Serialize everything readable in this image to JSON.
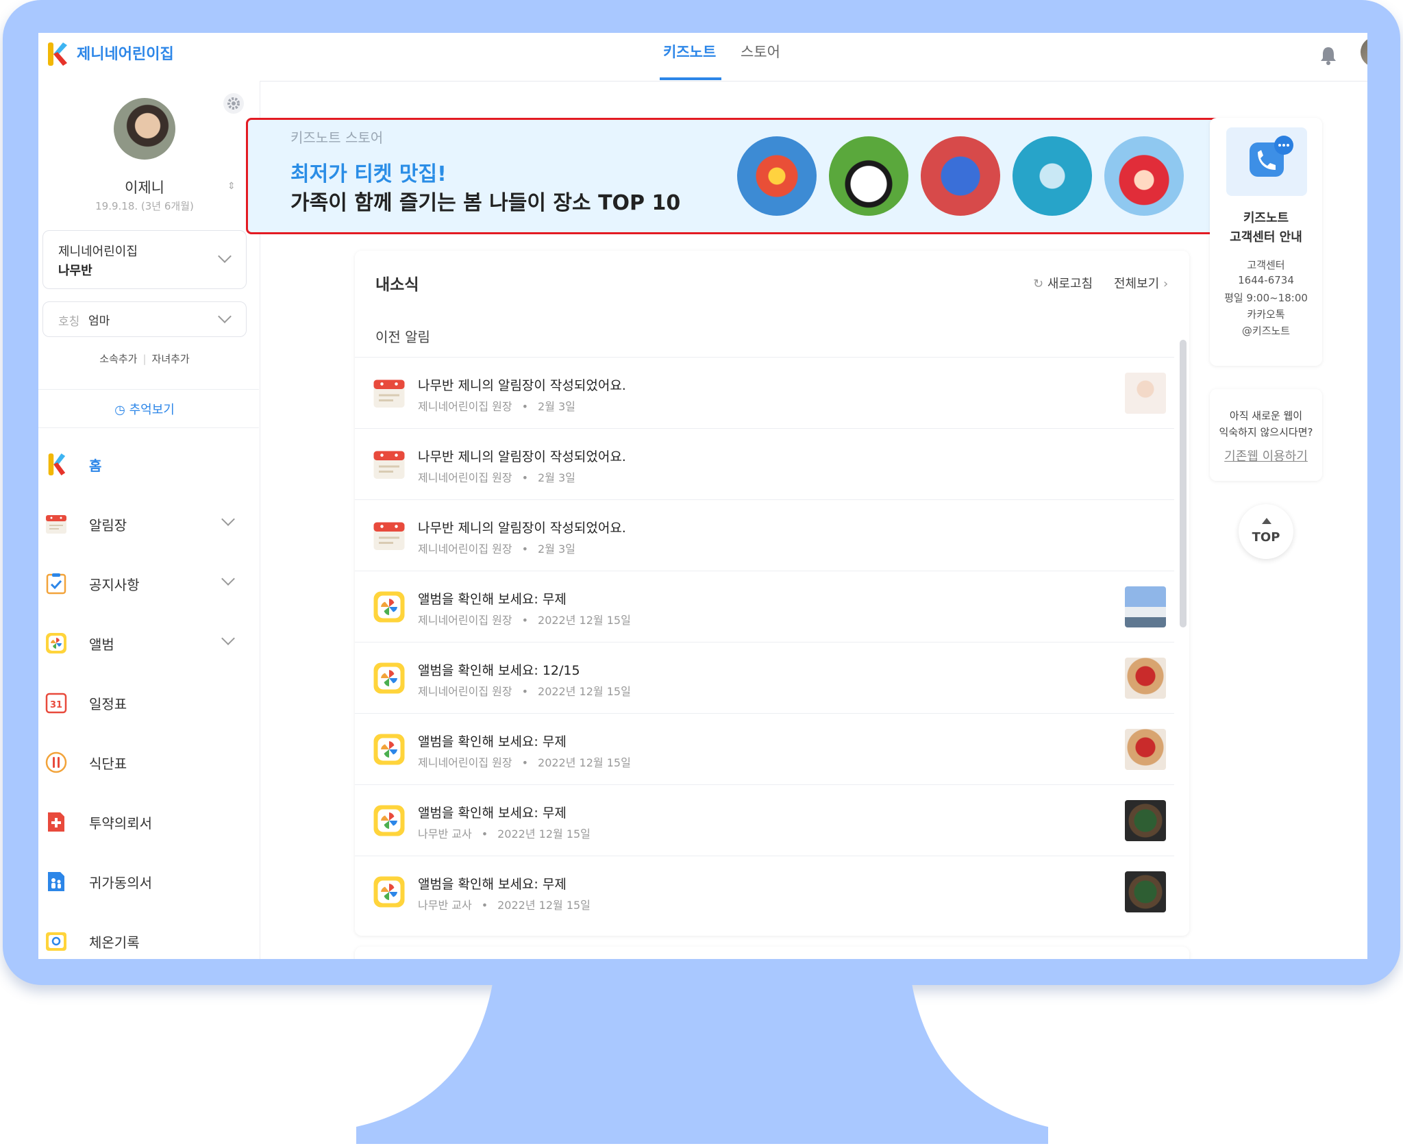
{
  "header": {
    "brand": "제니네어린이집",
    "tabs": [
      {
        "label": "키즈노트",
        "active": true
      },
      {
        "label": "스토어",
        "active": false
      }
    ]
  },
  "profile": {
    "name": "이제니",
    "birth": "19.9.18. (3년 6개월)",
    "school": "제니네어린이집",
    "class": "나무반",
    "title_label": "호칭",
    "title_value": "엄마",
    "add_affiliation": "소속추가",
    "add_child": "자녀추가",
    "memory_link": "추억보기"
  },
  "nav": [
    {
      "label": "홈",
      "active": true,
      "icon": "kidsnote-logo-icon",
      "chevron": false
    },
    {
      "label": "알림장",
      "active": false,
      "icon": "notebook-icon",
      "chevron": true
    },
    {
      "label": "공지사항",
      "active": false,
      "icon": "clipboard-check-icon",
      "chevron": true
    },
    {
      "label": "앨범",
      "active": false,
      "icon": "pinwheel-icon",
      "chevron": true
    },
    {
      "label": "일정표",
      "active": false,
      "icon": "calendar-icon",
      "chevron": false
    },
    {
      "label": "식단표",
      "active": false,
      "icon": "fork-spoon-icon",
      "chevron": false
    },
    {
      "label": "투약의뢰서",
      "active": false,
      "icon": "medical-kit-icon",
      "chevron": false
    },
    {
      "label": "귀가동의서",
      "active": false,
      "icon": "family-document-icon",
      "chevron": false
    },
    {
      "label": "체온기록",
      "active": false,
      "icon": "thermometer-icon",
      "chevron": false
    }
  ],
  "calendar_icon_text": "31",
  "banner": {
    "store_label": "키즈노트 스토어",
    "title1": "최저가 티켓 맛집!",
    "title2": "가족이 함께 즐기는 봄 나들이 장소 TOP 10"
  },
  "news": {
    "title": "내소식",
    "refresh": "새로고침",
    "view_all": "전체보기",
    "prev_label": "이전 알림",
    "items": [
      {
        "icon": "notebook-icon",
        "title": "나무반 제니의 알림장이 작성되었어요.",
        "author": "제니네어린이집 원장",
        "date": "2월 3일",
        "thumb": true
      },
      {
        "icon": "notebook-icon",
        "title": "나무반 제니의 알림장이 작성되었어요.",
        "author": "제니네어린이집 원장",
        "date": "2월 3일",
        "thumb": false
      },
      {
        "icon": "notebook-icon",
        "title": "나무반 제니의 알림장이 작성되었어요.",
        "author": "제니네어린이집 원장",
        "date": "2월 3일",
        "thumb": false
      },
      {
        "icon": "pinwheel-icon",
        "title": "앨범을 확인해 보세요: 무제",
        "author": "제니네어린이집 원장",
        "date": "2022년 12월 15일",
        "thumb": true
      },
      {
        "icon": "pinwheel-icon",
        "title": "앨범을 확인해 보세요: 12/15",
        "author": "제니네어린이집 원장",
        "date": "2022년 12월 15일",
        "thumb": true
      },
      {
        "icon": "pinwheel-icon",
        "title": "앨범을 확인해 보세요: 무제",
        "author": "제니네어린이집 원장",
        "date": "2022년 12월 15일",
        "thumb": true
      },
      {
        "icon": "pinwheel-icon",
        "title": "앨범을 확인해 보세요: 무제",
        "author": "나무반 교사",
        "date": "2022년 12월 15일",
        "thumb": true
      },
      {
        "icon": "pinwheel-icon",
        "title": "앨범을 확인해 보세요: 무제",
        "author": "나무반 교사",
        "date": "2022년 12월 15일",
        "thumb": true
      }
    ]
  },
  "customer_service": {
    "title1": "키즈노트",
    "title2": "고객센터 안내",
    "lines": [
      "고객센터",
      "1644-6734",
      "평일 9:00~18:00",
      "카카오톡",
      "@키즈노트"
    ]
  },
  "old_web": {
    "line1": "아직 새로운 웹이",
    "line2": "익숙하지 않으시다면?",
    "link": "기존웹 이용하기"
  },
  "top_button": "TOP",
  "colors": {
    "accent": "#2c86e8",
    "banner_border": "#e31b23",
    "banner_bg": "#e7f5ff",
    "monitor": "#a9c8ff"
  }
}
